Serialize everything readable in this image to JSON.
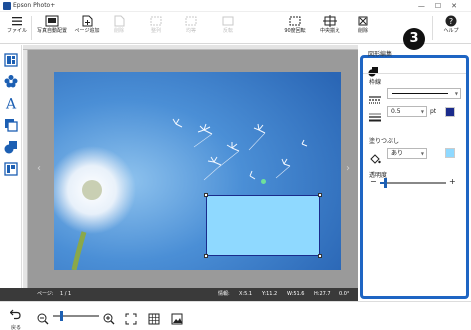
{
  "window": {
    "title": "Epson Photo+"
  },
  "toolbar": {
    "file": "ファイル",
    "auto_layout": "写真自動配置",
    "add_page": "ページ追加",
    "disabled_1": "削除",
    "disabled_2": "整列",
    "disabled_3": "均等",
    "disabled_4": "反転",
    "rotate90": "90度回転",
    "center": "中央揃え",
    "delete": "削除",
    "help": "ヘルプ"
  },
  "status": {
    "page_label": "ページ:",
    "page_value": "1 / 1",
    "info_label": "情報:",
    "x": "X:5.1",
    "y": "Y:11.2",
    "w": "W:51.6",
    "h": "H:27.7",
    "angle": "0.0°"
  },
  "bottom": {
    "back": "戻る"
  },
  "callout": {
    "number": "3"
  },
  "panel": {
    "header": "図形編集",
    "border_title": "枠線",
    "line_width": "0.5",
    "unit": "pt",
    "line_color": "#1a2b8c",
    "fill_title": "塗りつぶし",
    "fill_value": "あり",
    "fill_color": "#8fd9ff",
    "transparency_title": "透明度",
    "transparency_value": 0.08
  },
  "shape": {
    "fill_color": "#8fd9ff"
  }
}
